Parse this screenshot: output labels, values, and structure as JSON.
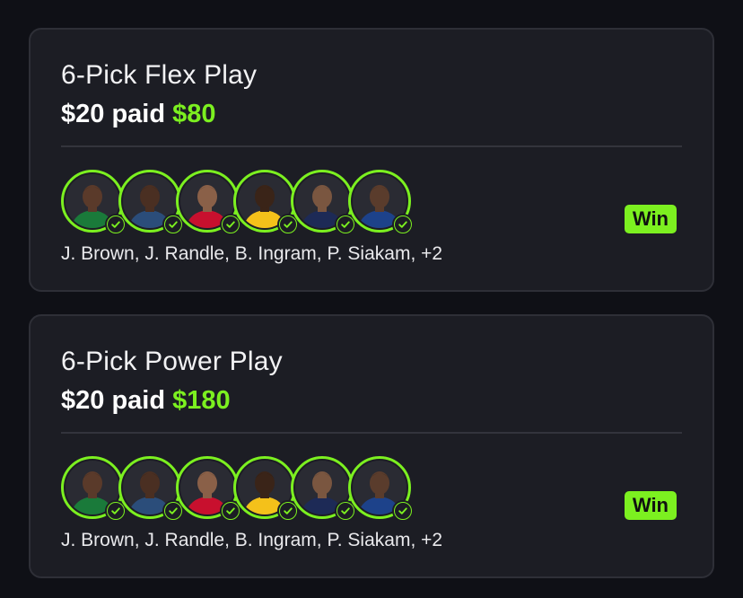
{
  "colors": {
    "background": "#0f1016",
    "card": "#1c1d24",
    "accent_green": "#7cf020",
    "text": "#ffffff"
  },
  "cards": [
    {
      "title": "6-Pick Flex Play",
      "paid_label": "$20 paid",
      "payout": "$80",
      "players_summary": "J. Brown, J. Randle, B. Ingram, P. Siakam, +2",
      "status": "Win",
      "avatars": [
        {
          "icon": "player-avatar-j-brown",
          "jersey": "#1a7a3a",
          "skin": "#5a3a2a"
        },
        {
          "icon": "player-avatar-j-randle",
          "jersey": "#2b4d7a",
          "skin": "#4a2f22"
        },
        {
          "icon": "player-avatar-b-ingram",
          "jersey": "#c8102e",
          "skin": "#8a6048"
        },
        {
          "icon": "player-avatar-p-siakam",
          "jersey": "#f4c11a",
          "skin": "#3a2418"
        },
        {
          "icon": "player-avatar-5",
          "jersey": "#1d2a56",
          "skin": "#7a5640"
        },
        {
          "icon": "player-avatar-6",
          "jersey": "#1d428a",
          "skin": "#5a3c2c"
        }
      ]
    },
    {
      "title": "6-Pick Power Play",
      "paid_label": "$20 paid",
      "payout": "$180",
      "players_summary": "J. Brown, J. Randle, B. Ingram, P. Siakam, +2",
      "status": "Win",
      "avatars": [
        {
          "icon": "player-avatar-j-brown",
          "jersey": "#1a7a3a",
          "skin": "#5a3a2a"
        },
        {
          "icon": "player-avatar-j-randle",
          "jersey": "#2b4d7a",
          "skin": "#4a2f22"
        },
        {
          "icon": "player-avatar-b-ingram",
          "jersey": "#c8102e",
          "skin": "#8a6048"
        },
        {
          "icon": "player-avatar-p-siakam",
          "jersey": "#f4c11a",
          "skin": "#3a2418"
        },
        {
          "icon": "player-avatar-5",
          "jersey": "#1d2a56",
          "skin": "#7a5640"
        },
        {
          "icon": "player-avatar-6",
          "jersey": "#1d428a",
          "skin": "#5a3c2c"
        }
      ]
    }
  ]
}
